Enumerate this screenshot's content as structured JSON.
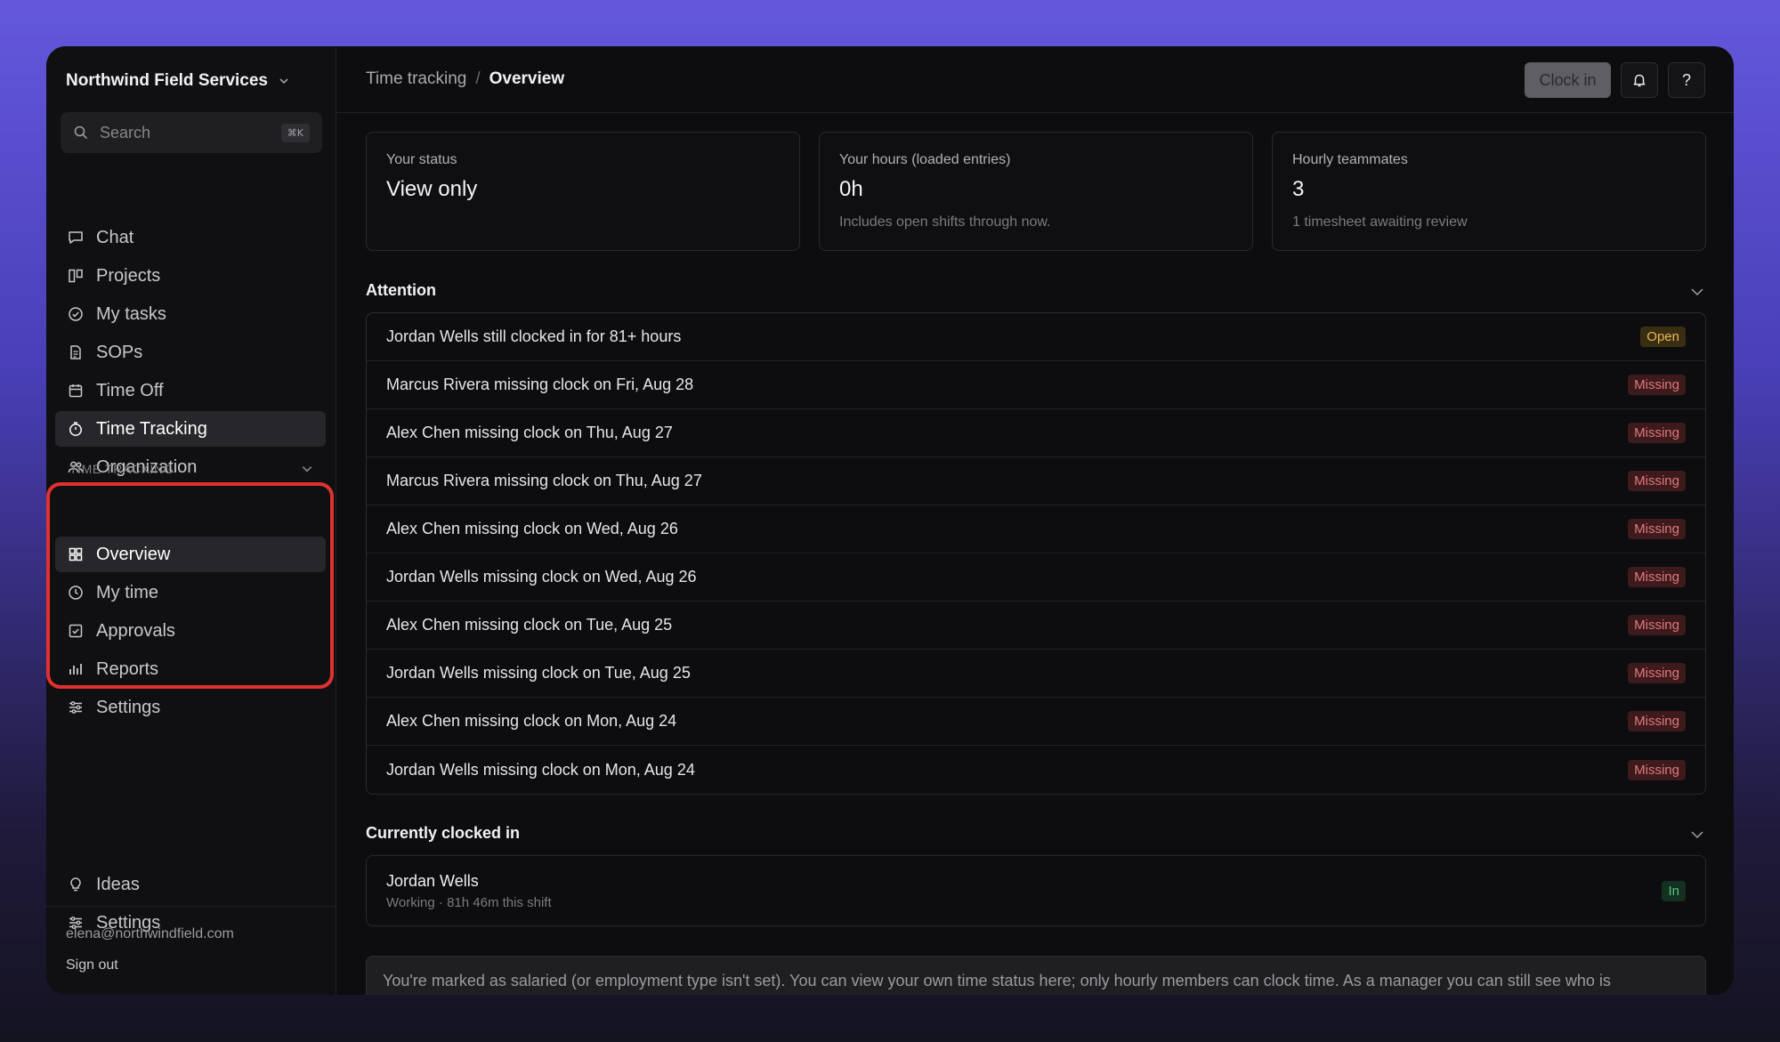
{
  "sidebar": {
    "org_name": "Northwind Field Services",
    "search_placeholder": "Search",
    "search_shortcut": "⌘K",
    "nav": [
      {
        "label": "Chat",
        "icon": "chat-icon"
      },
      {
        "label": "Projects",
        "icon": "board-icon"
      },
      {
        "label": "My tasks",
        "icon": "check-circle-icon"
      },
      {
        "label": "SOPs",
        "icon": "document-icon"
      },
      {
        "label": "Time Off",
        "icon": "calendar-icon"
      },
      {
        "label": "Time Tracking",
        "icon": "stopwatch-icon",
        "active": true
      },
      {
        "label": "Organization",
        "icon": "people-icon"
      }
    ],
    "section_label": "TIME TRACKING",
    "sub_nav": [
      {
        "label": "Overview",
        "icon": "grid-icon",
        "active": true
      },
      {
        "label": "My time",
        "icon": "clock-icon"
      },
      {
        "label": "Approvals",
        "icon": "checkbox-icon"
      },
      {
        "label": "Reports",
        "icon": "bar-chart-icon"
      },
      {
        "label": "Settings",
        "icon": "sliders-icon"
      }
    ],
    "bottom_nav": [
      {
        "label": "Ideas",
        "icon": "lightbulb-icon"
      },
      {
        "label": "Settings",
        "icon": "sliders-icon"
      }
    ],
    "user_email": "elena@northwindfield.com",
    "sign_out": "Sign out"
  },
  "header": {
    "breadcrumb_parent": "Time tracking",
    "breadcrumb_sep": "/",
    "breadcrumb_current": "Overview",
    "clock_in_label": "Clock in",
    "help_label": "?"
  },
  "cards": [
    {
      "label": "Your status",
      "value": "View only",
      "sub": ""
    },
    {
      "label": "Your hours (loaded entries)",
      "value": "0h",
      "sub": "Includes open shifts through now."
    },
    {
      "label": "Hourly teammates",
      "value": "3",
      "sub": "1 timesheet awaiting review"
    }
  ],
  "attention": {
    "title": "Attention",
    "items": [
      {
        "text": "Jordan Wells still clocked in for 81+ hours",
        "badge": "Open",
        "kind": "open"
      },
      {
        "text": "Marcus Rivera missing clock on Fri, Aug 28",
        "badge": "Missing",
        "kind": "missing"
      },
      {
        "text": "Alex Chen missing clock on Thu, Aug 27",
        "badge": "Missing",
        "kind": "missing"
      },
      {
        "text": "Marcus Rivera missing clock on Thu, Aug 27",
        "badge": "Missing",
        "kind": "missing"
      },
      {
        "text": "Alex Chen missing clock on Wed, Aug 26",
        "badge": "Missing",
        "kind": "missing"
      },
      {
        "text": "Jordan Wells missing clock on Wed, Aug 26",
        "badge": "Missing",
        "kind": "missing"
      },
      {
        "text": "Alex Chen missing clock on Tue, Aug 25",
        "badge": "Missing",
        "kind": "missing"
      },
      {
        "text": "Jordan Wells missing clock on Tue, Aug 25",
        "badge": "Missing",
        "kind": "missing"
      },
      {
        "text": "Alex Chen missing clock on Mon, Aug 24",
        "badge": "Missing",
        "kind": "missing"
      },
      {
        "text": "Jordan Wells missing clock on Mon, Aug 24",
        "badge": "Missing",
        "kind": "missing"
      }
    ]
  },
  "clocked_in": {
    "title": "Currently clocked in",
    "name": "Jordan Wells",
    "detail": "Working · 81h 46m this shift",
    "badge": "In"
  },
  "notice": "You're marked as salaried (or employment type isn't set). You can view your own time status here; only hourly members can clock time. As a manager you can still see who is"
}
